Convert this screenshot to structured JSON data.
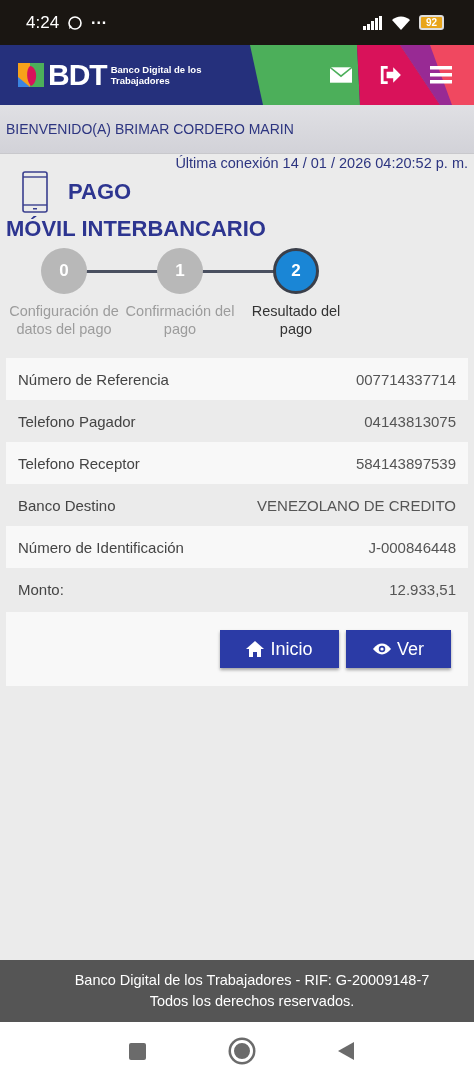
{
  "status_bar": {
    "time": "4:24",
    "more": "···",
    "battery": "92"
  },
  "header": {
    "logo_text": "BDT",
    "logo_subtitle": "Banco Digital de los Trabajadores"
  },
  "welcome": "BIENVENIDO(A) BRIMAR CORDERO MARIN",
  "last_connection": "Última conexión 14 / 01 / 2026 04:20:52 p. m.",
  "page_title": {
    "line_1": "PAGO",
    "line_2": "MÓVIL INTERBANCARIO"
  },
  "steps": [
    {
      "number": "0",
      "label": "Configuración de datos del pago",
      "selected": false
    },
    {
      "number": "1",
      "label": "Confirmación del pago",
      "selected": false
    },
    {
      "number": "2",
      "label": "Resultado del pago",
      "selected": true
    }
  ],
  "details": [
    {
      "label": "Número de Referencia",
      "value": "007714337714"
    },
    {
      "label": "Telefono Pagador",
      "value": "04143813075"
    },
    {
      "label": "Telefono Receptor",
      "value": "584143897539"
    },
    {
      "label": "Banco Destino",
      "value": "VENEZOLANO DE CREDITO"
    },
    {
      "label": "Número de Identificación",
      "value": "J-000846448"
    },
    {
      "label": "Monto:",
      "value": "12.933,51"
    }
  ],
  "buttons": [
    {
      "kind": "home",
      "label": "Inicio"
    },
    {
      "kind": "view",
      "label": "Ver"
    }
  ],
  "footer": {
    "line_1": "Banco Digital de los Trabajadores - RIF: G-20009148-7",
    "line_2": "Todos los derechos reservados."
  }
}
